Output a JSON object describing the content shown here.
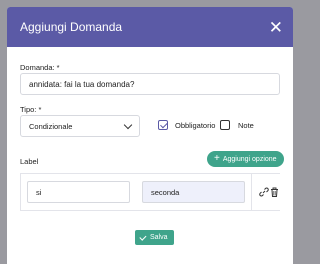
{
  "modal": {
    "title": "Aggiungi Domanda",
    "close_icon": "close-icon"
  },
  "form": {
    "question_label": "Domanda: *",
    "question_value": "annidata: fai la tua domanda?",
    "type_label": "Tipo: *",
    "type_selected": "Condizionale",
    "required_label": "Obbligatorio",
    "required_checked": true,
    "notes_label": "Note",
    "notes_checked": false,
    "options_label": "Label",
    "add_option_label": "Aggiungi opzione",
    "options": [
      {
        "first": "si",
        "second": "seconda"
      }
    ],
    "save_label": "Salva"
  },
  "colors": {
    "header": "#5b5aa6",
    "accent_green": "#3fa48b",
    "overlay": "#9a9aa0"
  }
}
